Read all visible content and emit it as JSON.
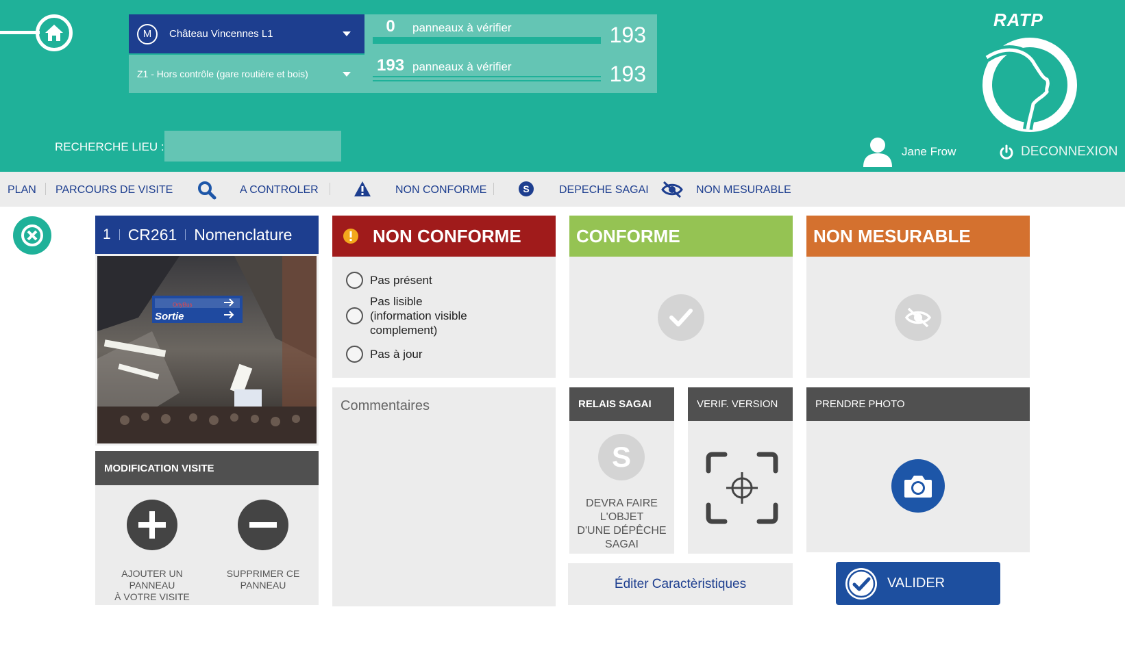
{
  "header": {
    "station": "Château Vincennes L1",
    "metro_badge": "M",
    "zone": "Z1 - Hors contrôle (gare routière et bois)",
    "counters": [
      {
        "count": "0",
        "label": "panneaux à vérifier",
        "total": "193",
        "progress": 1.0
      },
      {
        "count": "193",
        "label": "panneaux à vérifier",
        "total": "193",
        "progress": 0.0
      }
    ],
    "search_label": "RECHERCHE LIEU :",
    "search_value": "",
    "logo_text": "RATP",
    "user_name": "Jane Frow",
    "logout_label": "DECONNEXION"
  },
  "nav": {
    "plan": "PLAN",
    "parcours": "PARCOURS DE VISITE",
    "a_controler": "A CONTROLER",
    "non_conforme": "NON CONFORME",
    "depeche": "DEPECHE SAGAI",
    "non_mesurable": "NON MESURABLE"
  },
  "item": {
    "index": "1",
    "code": "CR261",
    "name": "Nomenclature",
    "photo_sign_text": "Sortie",
    "photo_sign_sub": "OrlyBus"
  },
  "modification": {
    "title": "MODIFICATION VISITE",
    "add_label": "AJOUTER UN\nPANNEAU\nÀ VOTRE VISITE",
    "remove_label": "SUPPRIMER CE\nPANNEAU"
  },
  "non_conforme": {
    "title": "NON CONFORME",
    "options": [
      "Pas présent",
      "Pas lisible\n(information visible\ncomplement)",
      "Pas à jour"
    ]
  },
  "comment": {
    "placeholder": "Commentaires",
    "value": ""
  },
  "conforme": {
    "title": "CONFORME"
  },
  "non_mesurable": {
    "title": "NON MESURABLE"
  },
  "relais": {
    "title": "RELAIS SAGAI",
    "icon_letter": "S",
    "text": "DEVRA FAIRE\nL'OBJET\nD'UNE DÉPÊCHE\nSAGAI"
  },
  "verif": {
    "title": "VERIF. VERSION"
  },
  "photo_action": {
    "title": "PRENDRE PHOTO"
  },
  "edit_label": "Éditer Caractèristiques",
  "validate_label": "VALIDER",
  "colors": {
    "teal": "#1fb199",
    "navy": "#1d3e8f",
    "red": "#a01b1b",
    "green": "#95c353",
    "orange": "#d4712f"
  }
}
